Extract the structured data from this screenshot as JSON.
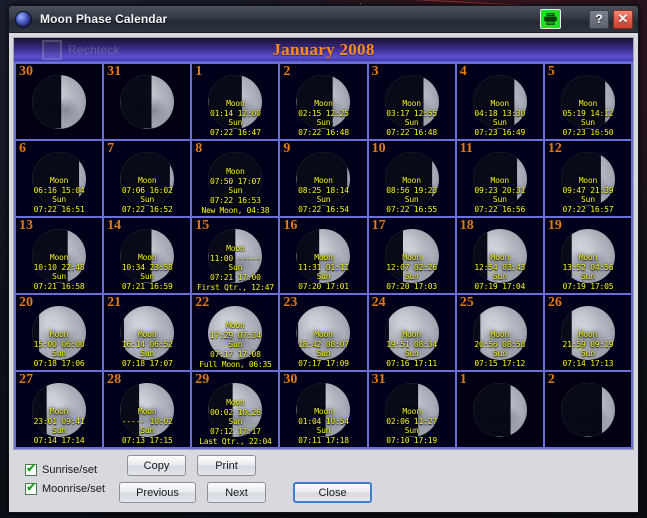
{
  "window": {
    "title": "Moon Phase Calendar",
    "app_icon": "moon-icon",
    "print_icon": "printer-icon",
    "help_label": "?",
    "close_label": "✕"
  },
  "calendar": {
    "month_title": "January 2008",
    "ghost_artifact_label": "Rechteck",
    "moon_label": "Moon",
    "sun_label": "Sun",
    "accent_daynum": "#e07a18",
    "accent_times": "#f5f51e",
    "accent_header": "#ff8c1a"
  },
  "days": [
    {
      "num": "30",
      "inactive": true,
      "phase": 0.46,
      "moon": "",
      "sun": "",
      "event": ""
    },
    {
      "num": "31",
      "inactive": true,
      "phase": 0.42,
      "moon": "",
      "sun": "",
      "event": ""
    },
    {
      "num": "1",
      "inactive": false,
      "phase": 0.38,
      "moon": "01:14  12:00",
      "sun": "07:22  16:47",
      "event": ""
    },
    {
      "num": "2",
      "inactive": false,
      "phase": 0.33,
      "moon": "02:15  12:25",
      "sun": "07:22  16:48",
      "event": ""
    },
    {
      "num": "3",
      "inactive": false,
      "phase": 0.28,
      "moon": "03:17  12:55",
      "sun": "07:22  16:48",
      "event": ""
    },
    {
      "num": "4",
      "inactive": false,
      "phase": 0.23,
      "moon": "04:18  13:30",
      "sun": "07:23  16:49",
      "event": ""
    },
    {
      "num": "5",
      "inactive": false,
      "phase": 0.18,
      "moon": "05:19  14:12",
      "sun": "07:23  16:50",
      "event": ""
    },
    {
      "num": "6",
      "inactive": false,
      "phase": 0.13,
      "moon": "06:16  15:04",
      "sun": "07:22  16:51",
      "event": ""
    },
    {
      "num": "7",
      "inactive": false,
      "phase": 0.08,
      "moon": "07:06  16:02",
      "sun": "07:22  16:52",
      "event": ""
    },
    {
      "num": "8",
      "inactive": false,
      "phase": 0.02,
      "moon": "07:50  17:07",
      "sun": "07:22  16:53",
      "event": "New Moon, 04:38"
    },
    {
      "num": "9",
      "inactive": false,
      "phase": 0.06,
      "moon": "08:25  18:14",
      "sun": "07:22  16:54",
      "event": ""
    },
    {
      "num": "10",
      "inactive": false,
      "phase": 0.12,
      "moon": "08:56  19:23",
      "sun": "07:22  16:55",
      "event": ""
    },
    {
      "num": "11",
      "inactive": false,
      "phase": 0.18,
      "moon": "09:23  20:31",
      "sun": "07:22  16:56",
      "event": ""
    },
    {
      "num": "12",
      "inactive": false,
      "phase": 0.26,
      "moon": "09:47  21:39",
      "sun": "07:22  16:57",
      "event": ""
    },
    {
      "num": "13",
      "inactive": false,
      "phase": 0.34,
      "moon": "10:10  22:48",
      "sun": "07:21  16:58",
      "event": ""
    },
    {
      "num": "14",
      "inactive": false,
      "phase": 0.42,
      "moon": "10:34  23:58",
      "sun": "07:21  16:59",
      "event": ""
    },
    {
      "num": "15",
      "inactive": false,
      "phase": 0.5,
      "moon": "11:00  -----",
      "sun": "07:21  17:00",
      "event": "First Qtr., 12:47"
    },
    {
      "num": "16",
      "inactive": false,
      "phase": 0.58,
      "moon": "11:31  01:11",
      "sun": "07:20  17:01",
      "event": ""
    },
    {
      "num": "17",
      "inactive": false,
      "phase": 0.66,
      "moon": "12:07  02:26",
      "sun": "07:20  17:03",
      "event": ""
    },
    {
      "num": "18",
      "inactive": false,
      "phase": 0.73,
      "moon": "12:54  03:43",
      "sun": "07:19  17:04",
      "event": ""
    },
    {
      "num": "19",
      "inactive": false,
      "phase": 0.8,
      "moon": "13:52  04:56",
      "sun": "07:19  17:05",
      "event": ""
    },
    {
      "num": "20",
      "inactive": false,
      "phase": 0.87,
      "moon": "15:00  06:00",
      "sun": "07:18  17:06",
      "event": ""
    },
    {
      "num": "21",
      "inactive": false,
      "phase": 0.93,
      "moon": "16:14  06:52",
      "sun": "07:18  17:07",
      "event": ""
    },
    {
      "num": "22",
      "inactive": false,
      "phase": 1.0,
      "moon": "17:29  07:34",
      "sun": "07:17  17:08",
      "event": "Full Moon, 06:35"
    },
    {
      "num": "23",
      "inactive": false,
      "phase": 0.97,
      "moon": "18:42  08:07",
      "sun": "07:17  17:09",
      "event": ""
    },
    {
      "num": "24",
      "inactive": false,
      "phase": 0.92,
      "moon": "19:51  08:34",
      "sun": "07:16  17:11",
      "event": ""
    },
    {
      "num": "25",
      "inactive": false,
      "phase": 0.86,
      "moon": "20:56  08:58",
      "sun": "07:15  17:12",
      "event": ""
    },
    {
      "num": "26",
      "inactive": false,
      "phase": 0.8,
      "moon": "21:59  09:19",
      "sun": "07:14  17:13",
      "event": ""
    },
    {
      "num": "27",
      "inactive": false,
      "phase": 0.73,
      "moon": "23:01  09:41",
      "sun": "07:14  17:14",
      "event": ""
    },
    {
      "num": "28",
      "inactive": false,
      "phase": 0.65,
      "moon": "-----  10:02",
      "sun": "07:13  17:15",
      "event": ""
    },
    {
      "num": "29",
      "inactive": false,
      "phase": 0.55,
      "moon": "00:02  10:26",
      "sun": "07:12  17:17",
      "event": "Last Qtr., 22:04"
    },
    {
      "num": "30",
      "inactive": false,
      "phase": 0.46,
      "moon": "01:04  10:54",
      "sun": "07:11  17:18",
      "event": ""
    },
    {
      "num": "31",
      "inactive": false,
      "phase": 0.38,
      "moon": "02:06  11:27",
      "sun": "07:10  17:19",
      "event": ""
    },
    {
      "num": "1",
      "inactive": true,
      "phase": 0.3,
      "moon": "",
      "sun": "",
      "event": ""
    },
    {
      "num": "2",
      "inactive": true,
      "phase": 0.24,
      "moon": "",
      "sun": "",
      "event": ""
    }
  ],
  "footer": {
    "checkboxes": [
      {
        "label": "Sunrise/set",
        "checked": true,
        "tick": "✔"
      },
      {
        "label": "Moonrise/set",
        "checked": true,
        "tick": "✔"
      }
    ],
    "buttons_row1": [
      {
        "label": "Copy",
        "name": "copy-button"
      },
      {
        "label": "Print",
        "name": "print-button"
      }
    ],
    "buttons_row2": [
      {
        "label": "Previous",
        "name": "previous-button"
      },
      {
        "label": "Next",
        "name": "next-button"
      },
      {
        "label": "Close",
        "name": "close-button"
      }
    ]
  }
}
